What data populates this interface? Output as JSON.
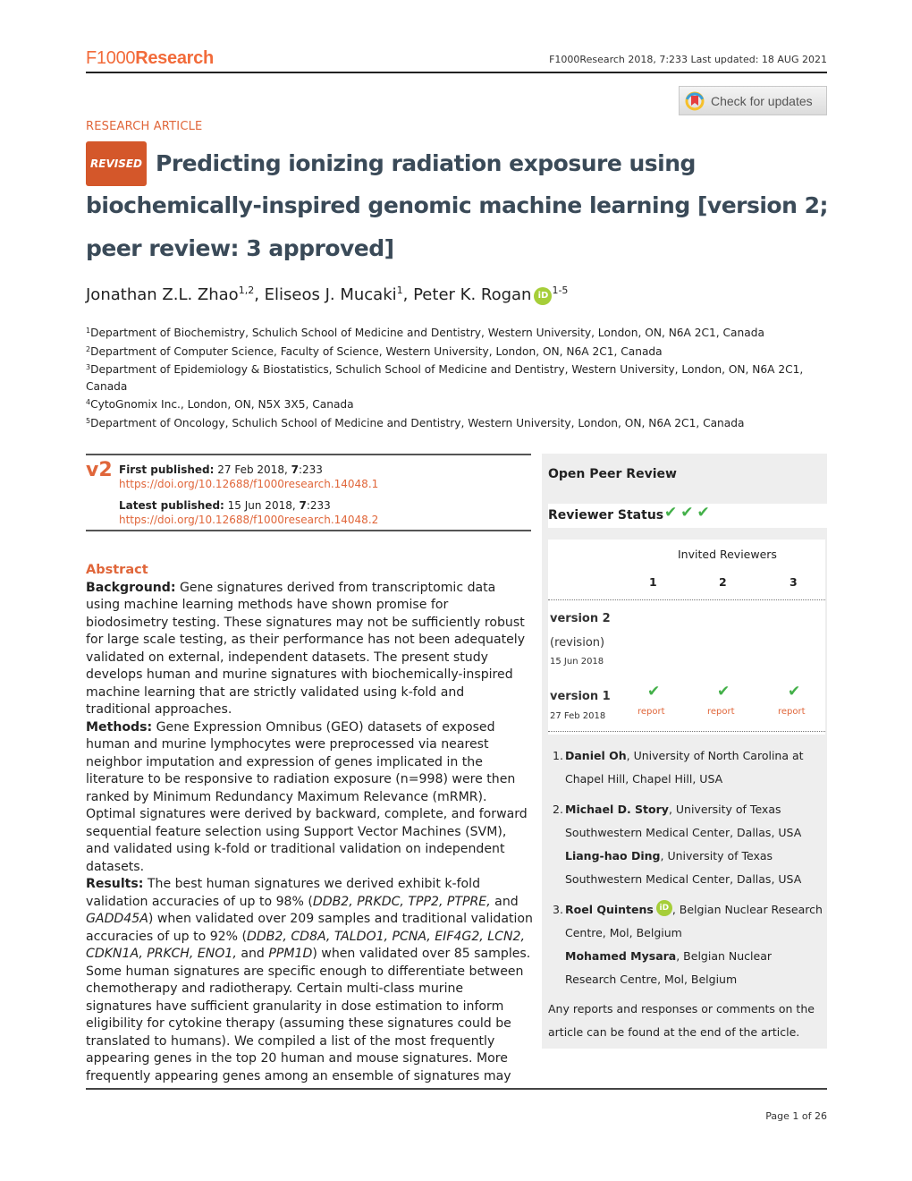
{
  "header": {
    "logo_f1000": "F1000",
    "logo_research": "Research",
    "citation": "F1000Research 2018, 7:233 Last updated: 18 AUG 2021",
    "check_updates_label": "Check for updates"
  },
  "article": {
    "type": "RESEARCH ARTICLE",
    "revised_badge": "REVISED",
    "title_line1": "Predicting ionizing radiation exposure using",
    "title_line2": "biochemically-inspired genomic machine learning",
    "title_version_a": "[version 2;",
    "title_line3": "peer review: 3 approved]"
  },
  "authors": [
    {
      "name": "Jonathan Z.L. Zhao",
      "sup": "1,2",
      "sep": ", "
    },
    {
      "name": "Eliseos J. Mucaki",
      "sup": "1",
      "sep": ", "
    },
    {
      "name": "Peter K. Rogan",
      "sup": "1-5",
      "sep": "",
      "orcid": "iD"
    }
  ],
  "affiliations": [
    {
      "num": "1",
      "text": "Department of Biochemistry, Schulich School of Medicine and Dentistry, Western University, London, ON, N6A 2C1, Canada"
    },
    {
      "num": "2",
      "text": "Department of Computer Science, Faculty of Science, Western University, London, ON, N6A 2C1, Canada"
    },
    {
      "num": "3",
      "text": "Department of Epidemiology & Biostatistics, Schulich School of Medicine and Dentistry, Western University, London, ON, N6A 2C1, Canada"
    },
    {
      "num": "4",
      "text": "CytoGnomix Inc., London, ON, N5X 3X5, Canada"
    },
    {
      "num": "5",
      "text": "Department of Oncology, Schulich School of Medicine and Dentistry, Western University, London, ON, N6A 2C1, Canada"
    }
  ],
  "publication": {
    "version_mark": "v2",
    "first_label": "First published:",
    "first_date": " 27 Feb 2018, ",
    "first_vol": "7",
    "first_page": ":233",
    "first_doi": "https://doi.org/10.12688/f1000research.14048.1",
    "latest_label": "Latest published:",
    "latest_date": " 15 Jun 2018, ",
    "latest_vol": "7",
    "latest_page": ":233",
    "latest_doi": "https://doi.org/10.12688/f1000research.14048.2"
  },
  "abstract": {
    "heading": "Abstract",
    "background_label": "Background:",
    "background_text": " Gene signatures derived from transcriptomic data using machine learning methods have shown promise for biodosimetry testing. These signatures may not be sufficiently robust for large scale testing, as their performance has not been adequately validated on external, independent datasets. The present study develops human and murine signatures with biochemically-inspired machine learning that are strictly validated using k-fold and traditional approaches.",
    "methods_label": "Methods:",
    "methods_text": " Gene Expression Omnibus (GEO) datasets of exposed human and murine lymphocytes were preprocessed via nearest neighbor imputation and expression of genes implicated in the literature to be responsive to radiation exposure (n=998) were then ranked by Minimum Redundancy Maximum Relevance (mRMR). Optimal signatures were derived by backward, complete, and forward sequential feature selection using Support Vector Machines (SVM), and validated using k-fold or traditional validation on independent datasets.",
    "results_label": "Results:",
    "results_text_1": " The best human signatures we derived exhibit k-fold validation accuracies of up to 98% (",
    "genes_1": "DDB2,  PRKDC, TPP2, PTPRE,",
    "results_text_2": " and ",
    "genes_2": "GADD45A",
    "results_text_3": ") when validated over 209 samples and traditional validation accuracies of up to 92% (",
    "genes_3": "DDB2,  CD8A,  TALDO1,  PCNA,  EIF4G2,  LCN2,  CDKN1A,  PRKCH,  ENO1,",
    "results_text_4": "  and ",
    "genes_4": "PPM1D",
    "results_text_5": ") when validated over 85 samples. Some human signatures are specific enough to differentiate between chemotherapy and radiotherapy. Certain multi-class murine signatures have sufficient granularity in dose estimation to inform eligibility for cytokine therapy (assuming these signatures could be translated to humans). We compiled a list of the most frequently appearing genes in the top 20 human and mouse signatures. More frequently appearing genes among an ensemble of signatures may"
  },
  "review": {
    "title": "Open Peer Review",
    "status_label": "Reviewer Status",
    "status_checks": "✔✔✔",
    "invited_label": "Invited Reviewers",
    "columns": [
      "1",
      "2",
      "3"
    ],
    "versions": [
      {
        "label": "version 2",
        "sub": "(revision)",
        "date": "15 Jun 2018",
        "reports": []
      },
      {
        "label": "version 1",
        "sub": "",
        "date": "27 Feb 2018",
        "reports": [
          "report",
          "report",
          "report"
        ]
      }
    ],
    "check_glyph": "✔",
    "reviewers": [
      {
        "num": "1.",
        "entries": [
          {
            "name": "Daniel Oh",
            "affil": ", University of North Carolina at Chapel Hill, Chapel Hill, USA"
          }
        ]
      },
      {
        "num": "2.",
        "entries": [
          {
            "name": "Michael D. Story",
            "affil": ", University of Texas Southwestern Medical Center, Dallas, USA"
          },
          {
            "name": "Liang-hao Ding",
            "affil": ", University of Texas Southwestern Medical Center, Dallas, USA"
          }
        ]
      },
      {
        "num": "3.",
        "entries": [
          {
            "name": "Roel Quintens",
            "orcid": "iD",
            "affil": ", Belgian Nuclear Research Centre, Mol, Belgium"
          },
          {
            "name": "Mohamed Mysara",
            "affil": ", Belgian Nuclear Research Centre, Mol, Belgium"
          }
        ]
      }
    ],
    "footer": "Any reports and responses or comments on the article can be found at the end of the article."
  },
  "footer": {
    "page": "Page 1 of 26"
  },
  "colors": {
    "brand_orange": "#f26b3a",
    "accent_orange": "#e0663a",
    "revised_badge": "#d4572a",
    "title_slate": "#3a4a58",
    "approved_green": "#43b049",
    "orcid_green": "#a6ce39"
  }
}
